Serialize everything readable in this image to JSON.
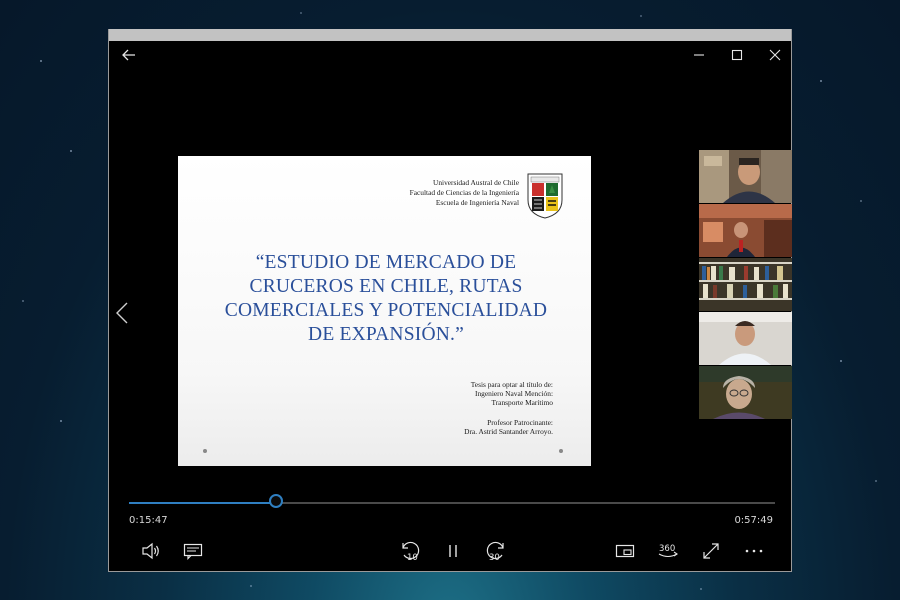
{
  "player": {
    "current_time": "0:15:47",
    "total_time": "0:57:49",
    "progress_fraction": 0.2275,
    "accent_color": "#2f7fc1",
    "skip_back_seconds": "10",
    "skip_forward_seconds": "30",
    "vr_label": "360"
  },
  "slide": {
    "institution": [
      "Universidad Austral de Chile",
      "Facultad de Ciencias de la Ingeniería",
      "Escuela de Ingeniería Naval"
    ],
    "title_lines": [
      "“ESTUDIO DE MERCADO DE",
      "CRUCEROS EN CHILE, RUTAS",
      "COMERCIALES Y POTENCIALIDAD",
      "DE EXPANSIÓN.”"
    ],
    "thesis_lines": [
      "Tesis para optar al título de:",
      "Ingeniero Naval  Mención:",
      "Transporte Marítimo"
    ],
    "sponsor_lines": [
      "Profesor Patrocinante:",
      "Dra. Astrid Santander Arroyo."
    ],
    "title_color": "#2a4f9a"
  },
  "icons": {
    "back": "back-arrow-icon",
    "minimize": "minimize-icon",
    "maximize": "maximize-icon",
    "close": "close-icon",
    "previous": "chevron-left-icon",
    "volume": "volume-icon",
    "captions": "captions-icon",
    "skip_back": "skip-back-10-icon",
    "pause": "pause-icon",
    "skip_forward": "skip-forward-30-icon",
    "mini_view": "mini-view-icon",
    "vr_360": "vr-360-icon",
    "fullscreen": "fullscreen-icon",
    "more": "more-icon"
  }
}
